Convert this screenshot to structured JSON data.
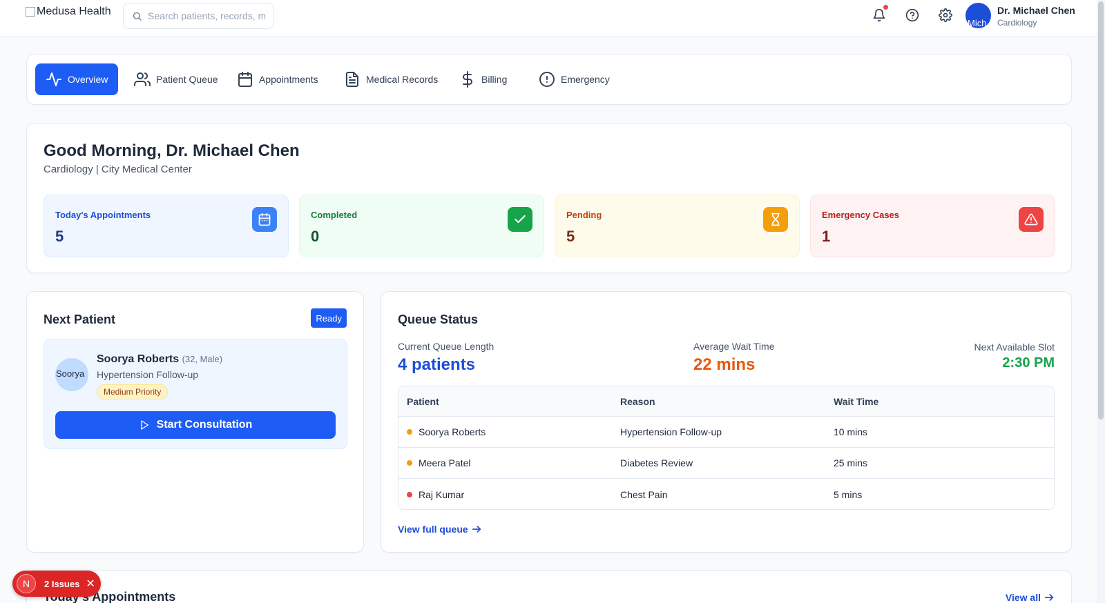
{
  "header": {
    "logo_alt": "Medusa Health",
    "search_placeholder": "Search patients, records, m",
    "user": {
      "name": "Dr. Michael Chen",
      "role": "Cardiology",
      "avatar_alt": "Mich"
    },
    "notification_dot_color": "#ef4444"
  },
  "tabs": [
    {
      "label": "Overview",
      "icon": "activity-icon",
      "active": true
    },
    {
      "label": "Patient Queue",
      "icon": "users-icon",
      "active": false
    },
    {
      "label": "Appointments",
      "icon": "calendar-icon",
      "active": false
    },
    {
      "label": "Medical Records",
      "icon": "file-text-icon",
      "active": false
    },
    {
      "label": "Billing",
      "icon": "dollar-icon",
      "active": false
    },
    {
      "label": "Emergency",
      "icon": "alert-circle-icon",
      "active": false
    }
  ],
  "welcome": {
    "greeting": "Good Morning, Dr. Michael Chen",
    "subtitle": "Cardiology | City Medical Center"
  },
  "stats": [
    {
      "label": "Today's Appointments",
      "value": "5",
      "icon": "calendar-icon",
      "color": "#1d4ed8"
    },
    {
      "label": "Completed",
      "value": "0",
      "icon": "check-icon",
      "color": "#15803d"
    },
    {
      "label": "Pending",
      "value": "5",
      "icon": "hourglass-icon",
      "color": "#c2410c"
    },
    {
      "label": "Emergency Cases",
      "value": "1",
      "icon": "warning-triangle-icon",
      "color": "#b91c1c"
    }
  ],
  "next_patient": {
    "title": "Next Patient",
    "status": "Ready",
    "name": "Soorya Roberts",
    "meta": "(32, Male)",
    "avatar_alt": "Soorya",
    "reason": "Hypertension Follow-up",
    "priority": "Medium Priority",
    "action": "Start Consultation"
  },
  "queue": {
    "title": "Queue Status",
    "length_label": "Current Queue Length",
    "length_value": "4 patients",
    "wait_label": "Average Wait Time",
    "wait_value": "22 mins",
    "slot_label": "Next Available Slot",
    "slot_value": "2:30 PM",
    "columns": [
      "Patient",
      "Reason",
      "Wait Time"
    ],
    "rows": [
      {
        "patient": "Soorya Roberts",
        "reason": "Hypertension Follow-up",
        "wait": "10 mins",
        "dot_color": "#f59e0b"
      },
      {
        "patient": "Meera Patel",
        "reason": "Diabetes Review",
        "wait": "25 mins",
        "dot_color": "#f59e0b"
      },
      {
        "patient": "Raj Kumar",
        "reason": "Chest Pain",
        "wait": "5 mins",
        "dot_color": "#ef4444"
      }
    ],
    "view_link": "View full queue"
  },
  "appointments": {
    "title": "Today's Appointments",
    "view_link": "View all"
  },
  "issues_toast": {
    "badge": "N",
    "label": "2 Issues"
  }
}
